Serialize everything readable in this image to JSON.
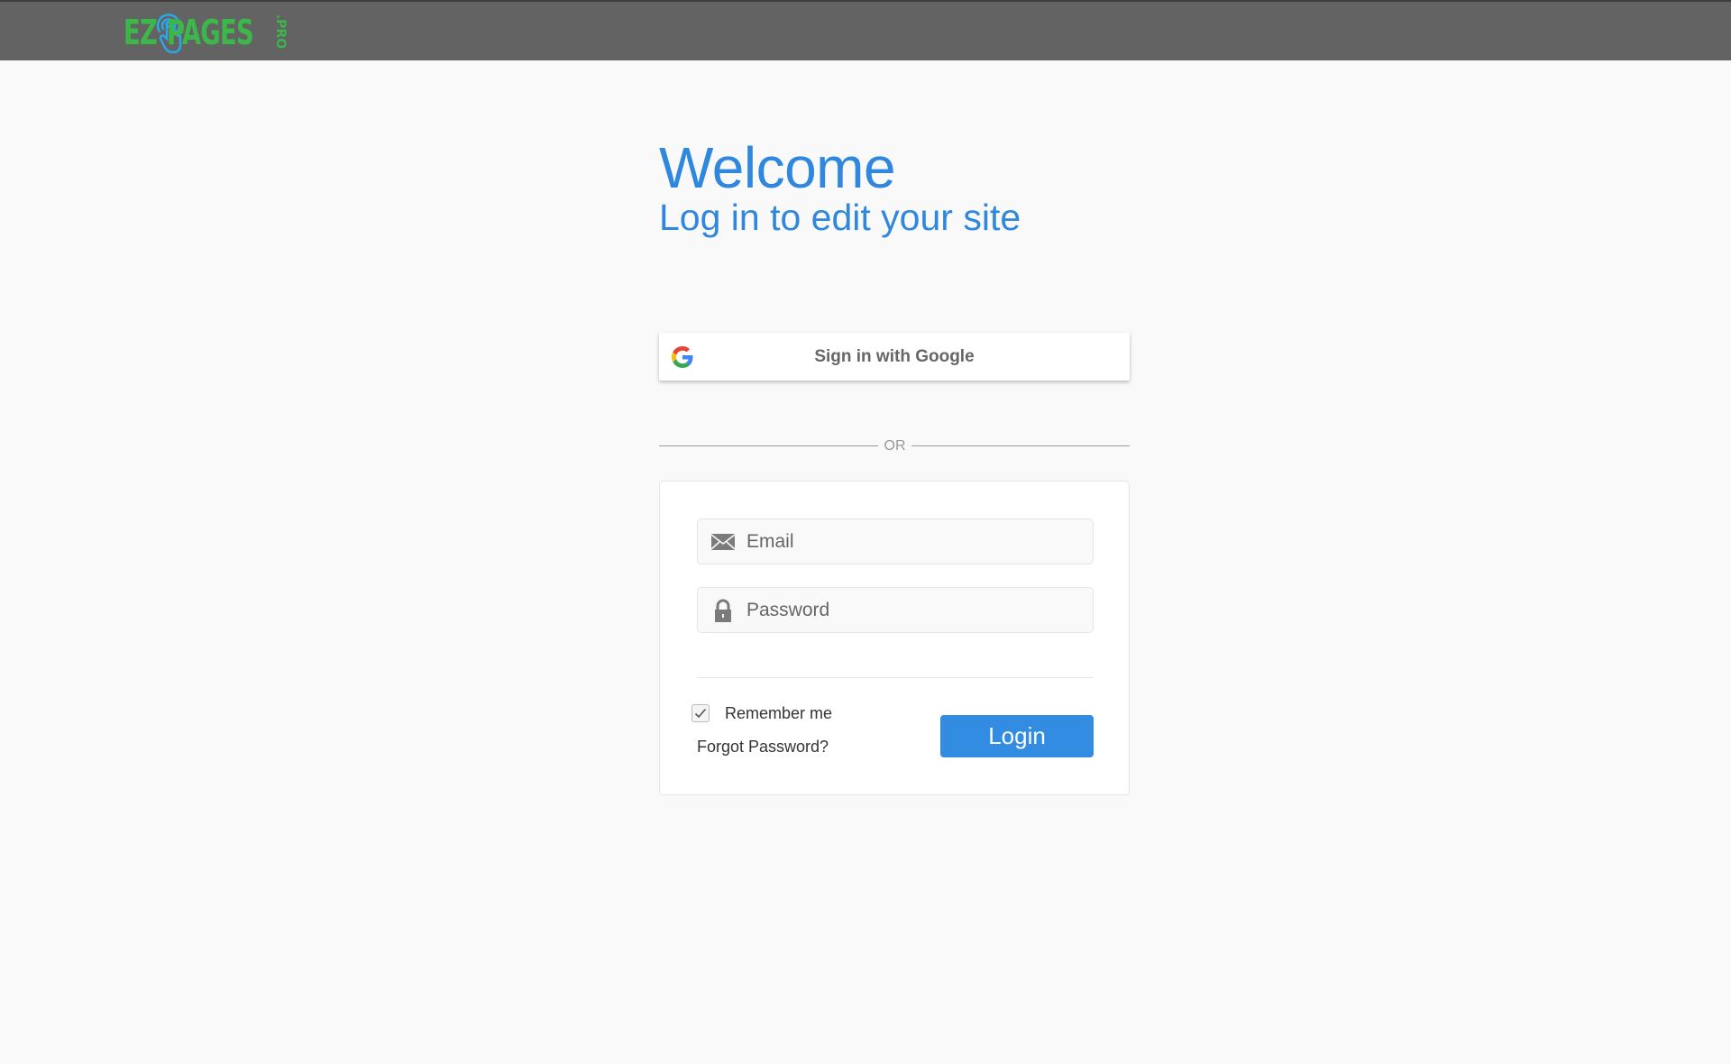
{
  "header": {
    "logo": {
      "left_text": "EZ",
      "main_text": "PAGES",
      "suffix": ".PRO"
    }
  },
  "hero": {
    "title": "Welcome",
    "subtitle": "Log in to edit your site"
  },
  "google_button": {
    "label": "Sign in with Google",
    "icon": "google-g-icon"
  },
  "separator": {
    "label": "OR"
  },
  "form": {
    "email": {
      "placeholder": "Email",
      "value": "",
      "icon": "envelope-icon"
    },
    "password": {
      "placeholder": "Password",
      "value": "",
      "icon": "padlock-icon"
    },
    "remember_me": {
      "label": "Remember me",
      "checked": true
    },
    "forgot_password": "Forgot Password?",
    "login_label": "Login"
  },
  "colors": {
    "accent": "#318ce2",
    "header_bg": "#636363",
    "logo_green": "#3cb84a",
    "logo_blue": "#29a8ec"
  }
}
